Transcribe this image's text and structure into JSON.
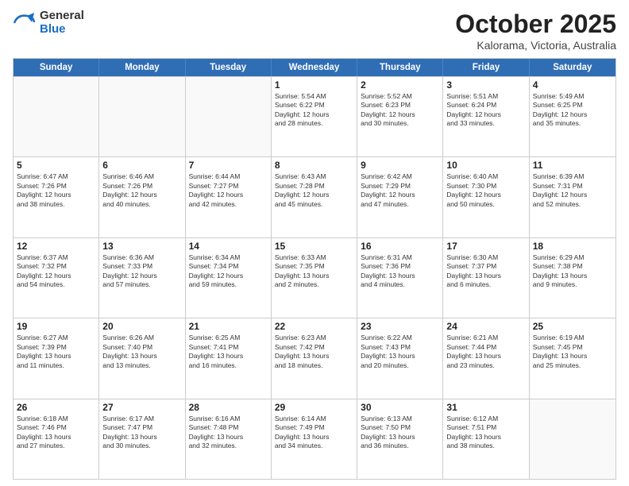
{
  "header": {
    "logo_general": "General",
    "logo_blue": "Blue",
    "month": "October 2025",
    "location": "Kalorama, Victoria, Australia"
  },
  "days_of_week": [
    "Sunday",
    "Monday",
    "Tuesday",
    "Wednesday",
    "Thursday",
    "Friday",
    "Saturday"
  ],
  "weeks": [
    [
      {
        "day": "",
        "info": ""
      },
      {
        "day": "",
        "info": ""
      },
      {
        "day": "",
        "info": ""
      },
      {
        "day": "1",
        "info": "Sunrise: 5:54 AM\nSunset: 6:22 PM\nDaylight: 12 hours\nand 28 minutes."
      },
      {
        "day": "2",
        "info": "Sunrise: 5:52 AM\nSunset: 6:23 PM\nDaylight: 12 hours\nand 30 minutes."
      },
      {
        "day": "3",
        "info": "Sunrise: 5:51 AM\nSunset: 6:24 PM\nDaylight: 12 hours\nand 33 minutes."
      },
      {
        "day": "4",
        "info": "Sunrise: 5:49 AM\nSunset: 6:25 PM\nDaylight: 12 hours\nand 35 minutes."
      }
    ],
    [
      {
        "day": "5",
        "info": "Sunrise: 6:47 AM\nSunset: 7:26 PM\nDaylight: 12 hours\nand 38 minutes."
      },
      {
        "day": "6",
        "info": "Sunrise: 6:46 AM\nSunset: 7:26 PM\nDaylight: 12 hours\nand 40 minutes."
      },
      {
        "day": "7",
        "info": "Sunrise: 6:44 AM\nSunset: 7:27 PM\nDaylight: 12 hours\nand 42 minutes."
      },
      {
        "day": "8",
        "info": "Sunrise: 6:43 AM\nSunset: 7:28 PM\nDaylight: 12 hours\nand 45 minutes."
      },
      {
        "day": "9",
        "info": "Sunrise: 6:42 AM\nSunset: 7:29 PM\nDaylight: 12 hours\nand 47 minutes."
      },
      {
        "day": "10",
        "info": "Sunrise: 6:40 AM\nSunset: 7:30 PM\nDaylight: 12 hours\nand 50 minutes."
      },
      {
        "day": "11",
        "info": "Sunrise: 6:39 AM\nSunset: 7:31 PM\nDaylight: 12 hours\nand 52 minutes."
      }
    ],
    [
      {
        "day": "12",
        "info": "Sunrise: 6:37 AM\nSunset: 7:32 PM\nDaylight: 12 hours\nand 54 minutes."
      },
      {
        "day": "13",
        "info": "Sunrise: 6:36 AM\nSunset: 7:33 PM\nDaylight: 12 hours\nand 57 minutes."
      },
      {
        "day": "14",
        "info": "Sunrise: 6:34 AM\nSunset: 7:34 PM\nDaylight: 12 hours\nand 59 minutes."
      },
      {
        "day": "15",
        "info": "Sunrise: 6:33 AM\nSunset: 7:35 PM\nDaylight: 13 hours\nand 2 minutes."
      },
      {
        "day": "16",
        "info": "Sunrise: 6:31 AM\nSunset: 7:36 PM\nDaylight: 13 hours\nand 4 minutes."
      },
      {
        "day": "17",
        "info": "Sunrise: 6:30 AM\nSunset: 7:37 PM\nDaylight: 13 hours\nand 6 minutes."
      },
      {
        "day": "18",
        "info": "Sunrise: 6:29 AM\nSunset: 7:38 PM\nDaylight: 13 hours\nand 9 minutes."
      }
    ],
    [
      {
        "day": "19",
        "info": "Sunrise: 6:27 AM\nSunset: 7:39 PM\nDaylight: 13 hours\nand 11 minutes."
      },
      {
        "day": "20",
        "info": "Sunrise: 6:26 AM\nSunset: 7:40 PM\nDaylight: 13 hours\nand 13 minutes."
      },
      {
        "day": "21",
        "info": "Sunrise: 6:25 AM\nSunset: 7:41 PM\nDaylight: 13 hours\nand 16 minutes."
      },
      {
        "day": "22",
        "info": "Sunrise: 6:23 AM\nSunset: 7:42 PM\nDaylight: 13 hours\nand 18 minutes."
      },
      {
        "day": "23",
        "info": "Sunrise: 6:22 AM\nSunset: 7:43 PM\nDaylight: 13 hours\nand 20 minutes."
      },
      {
        "day": "24",
        "info": "Sunrise: 6:21 AM\nSunset: 7:44 PM\nDaylight: 13 hours\nand 23 minutes."
      },
      {
        "day": "25",
        "info": "Sunrise: 6:19 AM\nSunset: 7:45 PM\nDaylight: 13 hours\nand 25 minutes."
      }
    ],
    [
      {
        "day": "26",
        "info": "Sunrise: 6:18 AM\nSunset: 7:46 PM\nDaylight: 13 hours\nand 27 minutes."
      },
      {
        "day": "27",
        "info": "Sunrise: 6:17 AM\nSunset: 7:47 PM\nDaylight: 13 hours\nand 30 minutes."
      },
      {
        "day": "28",
        "info": "Sunrise: 6:16 AM\nSunset: 7:48 PM\nDaylight: 13 hours\nand 32 minutes."
      },
      {
        "day": "29",
        "info": "Sunrise: 6:14 AM\nSunset: 7:49 PM\nDaylight: 13 hours\nand 34 minutes."
      },
      {
        "day": "30",
        "info": "Sunrise: 6:13 AM\nSunset: 7:50 PM\nDaylight: 13 hours\nand 36 minutes."
      },
      {
        "day": "31",
        "info": "Sunrise: 6:12 AM\nSunset: 7:51 PM\nDaylight: 13 hours\nand 38 minutes."
      },
      {
        "day": "",
        "info": ""
      }
    ]
  ]
}
